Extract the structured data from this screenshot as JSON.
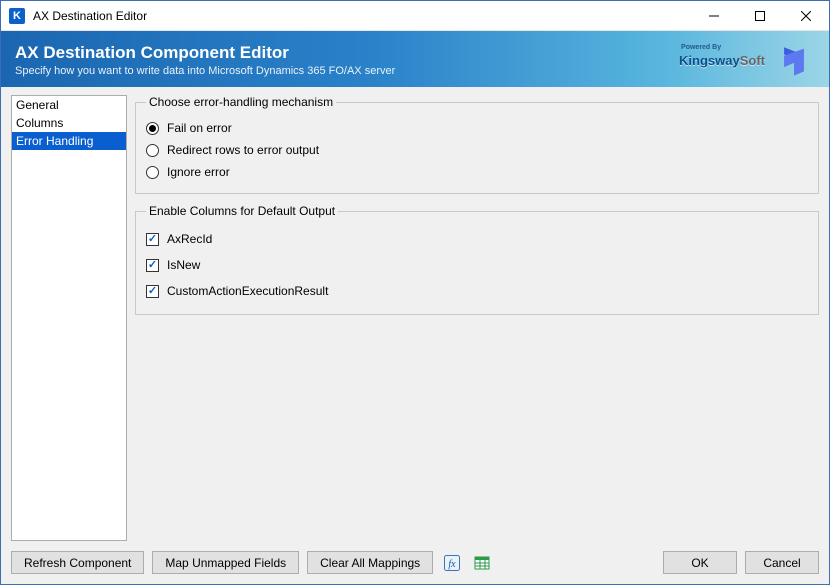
{
  "window": {
    "title": "AX Destination Editor"
  },
  "banner": {
    "title": "AX Destination Component Editor",
    "subtitle": "Specify how you want to write data into Microsoft Dynamics 365 FO/AX server",
    "powered_by": "Powered By",
    "brand_primary": "Kingsway",
    "brand_secondary": "Soft"
  },
  "sidebar": {
    "items": [
      {
        "label": "General",
        "selected": false
      },
      {
        "label": "Columns",
        "selected": false
      },
      {
        "label": "Error Handling",
        "selected": true
      }
    ]
  },
  "error_group": {
    "legend": "Choose error-handling mechanism",
    "options": [
      {
        "label": "Fail on error",
        "checked": true
      },
      {
        "label": "Redirect rows to error output",
        "checked": false
      },
      {
        "label": "Ignore error",
        "checked": false
      }
    ]
  },
  "columns_group": {
    "legend": "Enable Columns for Default Output",
    "options": [
      {
        "label": "AxRecId",
        "checked": true
      },
      {
        "label": "IsNew",
        "checked": true
      },
      {
        "label": "CustomActionExecutionResult",
        "checked": true
      }
    ]
  },
  "footer": {
    "refresh": "Refresh Component",
    "map": "Map Unmapped Fields",
    "clear": "Clear All Mappings",
    "ok": "OK",
    "cancel": "Cancel"
  },
  "icons": {
    "fx": "fx-icon",
    "table": "table-icon"
  }
}
